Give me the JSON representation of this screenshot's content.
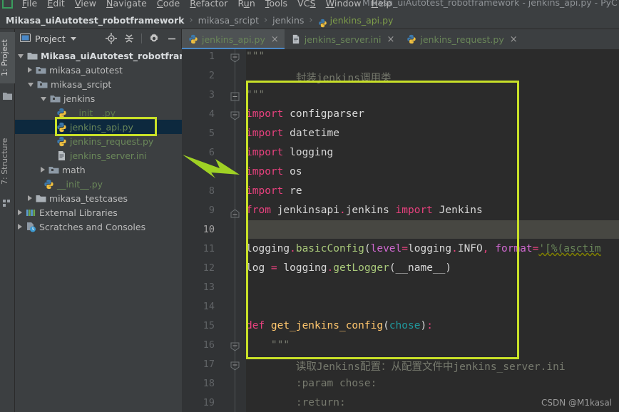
{
  "window": {
    "title": "Mikasa_uiAutotest_robotframework - jenkins_api.py - PyC",
    "app_icon": "pycharm-icon"
  },
  "menubar": {
    "items": [
      {
        "label": "File",
        "mnemonic": "F"
      },
      {
        "label": "Edit",
        "mnemonic": "E"
      },
      {
        "label": "View",
        "mnemonic": "V"
      },
      {
        "label": "Navigate",
        "mnemonic": "N"
      },
      {
        "label": "Code",
        "mnemonic": "C"
      },
      {
        "label": "Refactor",
        "mnemonic": "R"
      },
      {
        "label": "Run",
        "mnemonic": "u"
      },
      {
        "label": "Tools",
        "mnemonic": "T"
      },
      {
        "label": "VCS",
        "mnemonic": "S"
      },
      {
        "label": "Window",
        "mnemonic": "W"
      },
      {
        "label": "Help",
        "mnemonic": "H"
      }
    ]
  },
  "breadcrumb": {
    "separator": "›",
    "items": [
      {
        "label": "Mikasa_uiAutotest_robotframework",
        "style": "root"
      },
      {
        "label": "mikasa_srcipt",
        "style": "dim"
      },
      {
        "label": "jenkins",
        "style": "dim"
      },
      {
        "label": "jenkins_api.py",
        "style": "file",
        "icon": "python-file-icon"
      }
    ]
  },
  "toolstrip": {
    "project_label": "1: Project",
    "structure_label": "7: Structure"
  },
  "project_panel": {
    "title": "Project",
    "tools": [
      {
        "name": "locate-target-icon",
        "tooltip": "Select Opened File"
      },
      {
        "name": "collapse-all-icon",
        "tooltip": "Collapse All"
      },
      {
        "name": "gear-icon",
        "tooltip": "Settings"
      },
      {
        "name": "minimize-icon",
        "tooltip": "Hide"
      }
    ],
    "tree": [
      {
        "label": "Mikasa_uiAutotest_robotframew",
        "indent": 0,
        "arrow": "open",
        "icon": "folder-root-icon",
        "style": "bold"
      },
      {
        "label": "mikasa_autotest",
        "indent": 1,
        "arrow": "closed",
        "icon": "folder-module-icon",
        "style": "plain"
      },
      {
        "label": "mikasa_srcipt",
        "indent": 1,
        "arrow": "open",
        "icon": "folder-module-icon",
        "style": "plain"
      },
      {
        "label": "jenkins",
        "indent": 2,
        "arrow": "open",
        "icon": "folder-module-icon",
        "style": "plain"
      },
      {
        "label": "__init__.py",
        "indent": 3,
        "arrow": "none",
        "icon": "python-file-icon",
        "style": "dimgreen"
      },
      {
        "label": "jenkins_api.py",
        "indent": 3,
        "arrow": "none",
        "icon": "python-file-icon",
        "style": "green",
        "selected": true
      },
      {
        "label": "jenkins_request.py",
        "indent": 3,
        "arrow": "none",
        "icon": "python-file-icon",
        "style": "green"
      },
      {
        "label": "jenkins_server.ini",
        "indent": 3,
        "arrow": "none",
        "icon": "ini-file-icon",
        "style": "green"
      },
      {
        "label": "math",
        "indent": 2,
        "arrow": "closed",
        "icon": "folder-module-icon",
        "style": "plain"
      },
      {
        "label": "__init__.py",
        "indent": 2,
        "arrow": "none",
        "icon": "python-file-icon",
        "style": "green"
      },
      {
        "label": "mikasa_testcases",
        "indent": 1,
        "arrow": "closed",
        "icon": "folder-plain-icon",
        "style": "plain"
      },
      {
        "label": "External Libraries",
        "indent": 0,
        "arrow": "closed",
        "icon": "libraries-icon",
        "style": "plain"
      },
      {
        "label": "Scratches and Consoles",
        "indent": 0,
        "arrow": "closed",
        "icon": "scratches-icon",
        "style": "plain"
      }
    ]
  },
  "editor": {
    "tabs": [
      {
        "label": "jenkins_api.py",
        "icon": "python-file-icon",
        "active": true,
        "close": "×"
      },
      {
        "label": "jenkins_server.ini",
        "icon": "ini-file-icon",
        "active": false,
        "close": "×"
      },
      {
        "label": "jenkins_request.py",
        "icon": "python-file-icon",
        "active": false,
        "close": "×"
      }
    ],
    "caret_line": 10,
    "line_numbers": [
      1,
      2,
      3,
      4,
      5,
      6,
      7,
      8,
      9,
      10,
      11,
      12,
      13,
      14,
      15,
      16,
      17,
      18,
      19
    ],
    "lines": [
      {
        "n": 1,
        "text": "\"\"\""
      },
      {
        "n": 2,
        "text": "        封装jenkins调用类"
      },
      {
        "n": 3,
        "text": "\"\"\""
      },
      {
        "n": 4,
        "text": "import configparser"
      },
      {
        "n": 5,
        "text": "import datetime"
      },
      {
        "n": 6,
        "text": "import logging"
      },
      {
        "n": 7,
        "text": "import os"
      },
      {
        "n": 8,
        "text": "import re"
      },
      {
        "n": 9,
        "text": "from jenkinsapi.jenkins import Jenkins"
      },
      {
        "n": 10,
        "text": ""
      },
      {
        "n": 11,
        "text": "logging.basicConfig(level=logging.INFO, format='[%(asctim"
      },
      {
        "n": 12,
        "text": "log = logging.getLogger(__name__)"
      },
      {
        "n": 13,
        "text": ""
      },
      {
        "n": 14,
        "text": ""
      },
      {
        "n": 15,
        "text": "def get_jenkins_config(chose):"
      },
      {
        "n": 16,
        "text": "    \"\"\""
      },
      {
        "n": 17,
        "text": "        读取Jenkins配置：从配置文件中jenkins_server.ini"
      },
      {
        "n": 18,
        "text": "        :param chose:"
      },
      {
        "n": 19,
        "text": "        :return:"
      }
    ]
  },
  "annotations": {
    "highlight_color": "#c8e028",
    "arrow_color": "#9fd124",
    "tree_box_target": "jenkins_api.py",
    "code_box_target": "import block and function definition",
    "arrow_target_line": 6
  },
  "watermark": {
    "text": "CSDN @M1kasal"
  }
}
